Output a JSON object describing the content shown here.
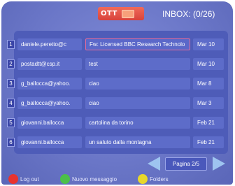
{
  "header": {
    "logo_text": "OTT",
    "inbox_title": "INBOX: (0/26)"
  },
  "messages": [
    {
      "num": "1",
      "from": "daniele.peretto@c",
      "subject": "Fw: Licensed BBC Research Technolo",
      "date": "Mar 10",
      "selected": true
    },
    {
      "num": "2",
      "from": "postadtt@csp.it",
      "subject": "test",
      "date": "Mar 10",
      "selected": false
    },
    {
      "num": "3",
      "from": "g_ballocca@yahoo.",
      "subject": "ciao",
      "date": "Mar 8",
      "selected": false
    },
    {
      "num": "4",
      "from": "g_ballocca@yahoo.",
      "subject": "ciao",
      "date": "Mar 3",
      "selected": false
    },
    {
      "num": "5",
      "from": "giovanni.ballocca",
      "subject": "cartolina da torino",
      "date": "Feb 21",
      "selected": false
    },
    {
      "num": "6",
      "from": "giovanni.ballocca",
      "subject": "un saluto dalla montagna",
      "date": "Feb 21",
      "selected": false
    }
  ],
  "pager": {
    "label": "Pagina 2/5"
  },
  "footer": {
    "buttons": [
      {
        "label": "Log out",
        "color": "#e8332e"
      },
      {
        "label": "Nuovo messaggio",
        "color": "#4cc04a"
      },
      {
        "label": "Folders",
        "color": "#e8d82a"
      }
    ]
  },
  "colors": {
    "background": "#6b77c8",
    "panel": "#4e5cb8",
    "selected_border": "#e46b9a",
    "logo": "#d8423b"
  }
}
